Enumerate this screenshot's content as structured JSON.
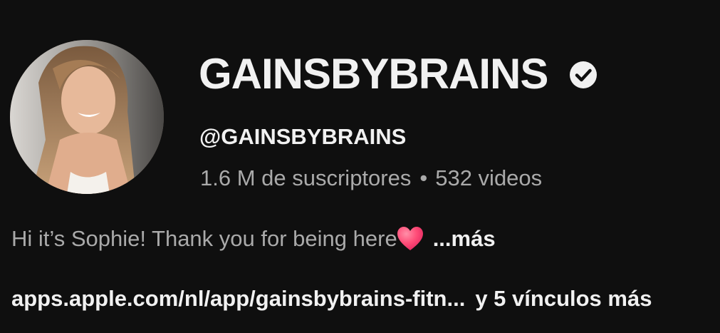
{
  "channel": {
    "name": "GAINSBYBRAINS",
    "handle": "@GAINSBYBRAINS",
    "subscribers": "1.6 M de suscriptores",
    "separator": "•",
    "videos": "532 videos",
    "verified": true
  },
  "description": {
    "text": "Hi it’s Sophie! Thank you for being here",
    "emoji_icon": "heart-icon",
    "more_label": "...más"
  },
  "links": {
    "primary": "apps.apple.com/nl/app/gainsbybrains-fitn...",
    "extra": "y 5 vínculos más"
  },
  "icons": {
    "verified": "check-circle-icon",
    "heart": "heart-icon"
  },
  "colors": {
    "background": "#0f0f0f",
    "text_primary": "#f1f1f1",
    "text_secondary": "#aaaaaa",
    "heart": "#ff3d6e"
  }
}
